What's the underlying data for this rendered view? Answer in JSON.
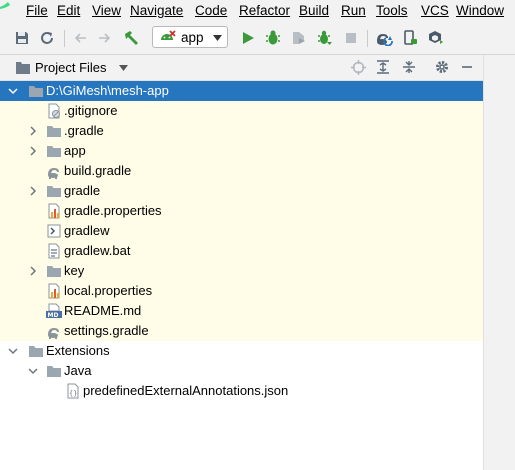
{
  "menu": {
    "items": [
      {
        "label": "File"
      },
      {
        "label": "Edit"
      },
      {
        "label": "View"
      },
      {
        "label": "Navigate"
      },
      {
        "label": "Code"
      },
      {
        "label": "Refactor"
      },
      {
        "label": "Build"
      },
      {
        "label": "Run"
      },
      {
        "label": "Tools"
      },
      {
        "label": "VCS"
      },
      {
        "label": "Window"
      }
    ]
  },
  "toolbar": {
    "run_config": "app",
    "icons": [
      "save-all-icon",
      "sync-icon",
      "back-icon",
      "forward-icon",
      "hammer-icon",
      "run-icon",
      "debug-icon",
      "profile-icon",
      "attach-debugger-icon",
      "stop-icon",
      "gradle-sync-icon",
      "device-manager-icon",
      "sdk-manager-icon"
    ]
  },
  "panel": {
    "title": "Project Files",
    "icons": [
      "locate-icon",
      "expand-all-icon",
      "collapse-all-icon",
      "gear-icon",
      "hide-icon"
    ]
  },
  "tree": [
    {
      "label": "D:\\GiMesh\\mesh-app",
      "icon": "folder-icon",
      "expanded": true
    },
    {
      "label": ".gitignore",
      "icon": "gitignore-file-icon"
    },
    {
      "label": ".gradle",
      "icon": "folder-icon",
      "expanded": false
    },
    {
      "label": "app",
      "icon": "folder-icon",
      "expanded": false
    },
    {
      "label": "build.gradle",
      "icon": "gradle-file-icon"
    },
    {
      "label": "gradle",
      "icon": "folder-icon",
      "expanded": false
    },
    {
      "label": "gradle.properties",
      "icon": "properties-file-icon"
    },
    {
      "label": "gradlew",
      "icon": "shell-script-icon"
    },
    {
      "label": "gradlew.bat",
      "icon": "batch-file-icon"
    },
    {
      "label": "key",
      "icon": "folder-icon",
      "expanded": false
    },
    {
      "label": "local.properties",
      "icon": "properties-file-icon"
    },
    {
      "label": "README.md",
      "icon": "markdown-file-icon"
    },
    {
      "label": "settings.gradle",
      "icon": "gradle-file-icon"
    },
    {
      "label": "Extensions",
      "icon": "folder-icon",
      "expanded": true
    },
    {
      "label": "Java",
      "icon": "folder-icon",
      "expanded": true
    },
    {
      "label": "predefinedExternalAnnotations.json",
      "icon": "json-file-icon"
    }
  ],
  "colors": {
    "selection": "#2675bf",
    "project_bg": "#fffde7",
    "toolbar_bg": "#f2f2f2",
    "run_green": "#3a9a3a"
  }
}
